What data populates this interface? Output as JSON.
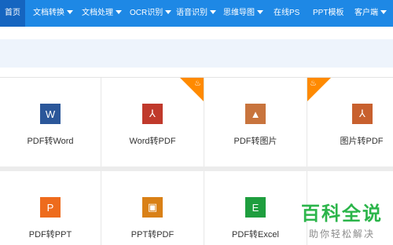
{
  "nav": {
    "items": [
      {
        "label": "首页",
        "dropdown": false,
        "active": true
      },
      {
        "label": "文档转换",
        "dropdown": true
      },
      {
        "label": "文档处理",
        "dropdown": true
      },
      {
        "label": "OCR识别",
        "dropdown": true
      },
      {
        "label": "语音识别",
        "dropdown": true
      },
      {
        "label": "思维导图",
        "dropdown": true
      },
      {
        "label": "在线PS",
        "dropdown": false
      },
      {
        "label": "PPT模板",
        "dropdown": false
      },
      {
        "label": "客户端",
        "dropdown": true
      }
    ]
  },
  "tools": {
    "row1": [
      {
        "label": "PDF转Word",
        "icon": "word-icon",
        "glyph": "W",
        "color": "#2b579a",
        "hot": false
      },
      {
        "label": "Word转PDF",
        "icon": "pdf-icon",
        "glyph": "⅄",
        "color": "#c0392b",
        "hot": true
      },
      {
        "label": "PDF转图片",
        "icon": "image-icon",
        "glyph": "▲",
        "color": "#c8743d",
        "hot": false
      },
      {
        "label": "图片转PDF",
        "icon": "pdf-icon",
        "glyph": "⅄",
        "color": "#c8602e",
        "hot": true
      }
    ],
    "row2": [
      {
        "label": "PDF转PPT",
        "icon": "ppt-icon",
        "glyph": "P",
        "color": "#ee6b1c"
      },
      {
        "label": "PPT转PDF",
        "icon": "ppt-pdf-icon",
        "glyph": "▣",
        "color": "#d98016"
      },
      {
        "label": "PDF转Excel",
        "icon": "excel-icon",
        "glyph": "E",
        "color": "#1e9e3e"
      }
    ]
  },
  "hot_badge_icon": "flame-icon",
  "watermark": {
    "title": "百科全说",
    "subtitle": "助你轻松解决"
  },
  "colors": {
    "nav_bg": "#1e88e5",
    "hot": "#ff8a00",
    "watermark": "#2bb54a"
  }
}
